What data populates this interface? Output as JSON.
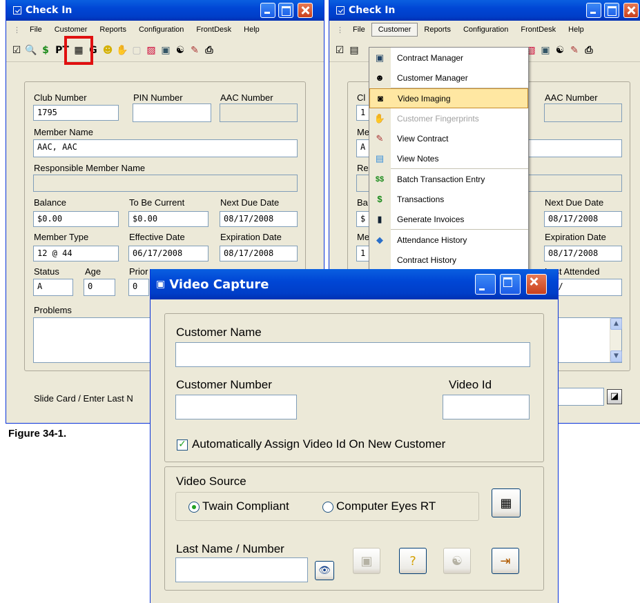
{
  "left_window": {
    "title": "Check In",
    "menu": [
      "File",
      "Customer",
      "Reports",
      "Configuration",
      "FrontDesk",
      "Help"
    ],
    "toolbar_icons": [
      "checkbox-icon",
      "search-doc-icon",
      "dollar-icon",
      "pt-icon",
      "video-icon",
      "g-icon",
      "smiley-icon",
      "hand-icon",
      "image-icon",
      "chart-icon",
      "contract-icon",
      "fingerprint-icon",
      "edit-icon",
      "print-icon"
    ],
    "toolbar_text": {
      "dollar": "$",
      "pt": "PT",
      "g": "G"
    },
    "fields": {
      "club_number_label": "Club Number",
      "club_number": "1795",
      "pin_number_label": "PIN Number",
      "pin_number": "",
      "aac_number_label": "AAC Number",
      "aac_number": "",
      "member_name_label": "Member Name",
      "member_name": "AAC, AAC",
      "responsible_label": "Responsible Member Name",
      "responsible": "",
      "balance_label": "Balance",
      "balance": "$0.00",
      "to_be_current_label": "To Be Current",
      "to_be_current": "$0.00",
      "next_due_label": "Next Due Date",
      "next_due": "08/17/2008",
      "member_type_label": "Member Type",
      "member_type": "12 @ 44",
      "effective_label": "Effective Date",
      "effective": "06/17/2008",
      "expiration_label": "Expiration Date",
      "expiration": "08/17/2008",
      "status_label": "Status",
      "status": "A",
      "age_label": "Age",
      "age": "0",
      "prior_label": "Prior",
      "prior": "0",
      "problems_label": "Problems"
    },
    "slide_card_label": "Slide Card / Enter Last N"
  },
  "right_window": {
    "title": "Check In",
    "menu": [
      "File",
      "Customer",
      "Reports",
      "Configuration",
      "FrontDesk",
      "Help"
    ],
    "aac_number_label": "AAC Number",
    "next_due_label": "Next Due Date",
    "next_due": "08/17/2008",
    "expiration_label": "Expiration Date",
    "expiration": "08/17/2008",
    "last_attended_label": "Last Attended",
    "last_attended": "/ /",
    "partial_labels": {
      "club": "Cl",
      "member": "Me",
      "resp": "Re",
      "balance": "Ba",
      "memtype": "Me"
    },
    "partial_values": {
      "club": "1",
      "member": "A",
      "balance": "$",
      "memtype": "1"
    },
    "customer_menu": [
      {
        "label": "Contract Manager",
        "icon": "contract-icon",
        "glyph": "▣",
        "state": "normal"
      },
      {
        "label": "Customer Manager",
        "icon": "customer-manager-icon",
        "glyph": "☻",
        "state": "normal"
      },
      {
        "label": "Video Imaging",
        "icon": "camera-icon",
        "glyph": "◙",
        "state": "highlighted"
      },
      {
        "label": "Customer Fingerprints",
        "icon": "hand-icon",
        "glyph": "✋",
        "state": "disabled"
      },
      {
        "label": "View Contract",
        "icon": "edit-icon",
        "glyph": "✎",
        "state": "normal"
      },
      {
        "label": "View Notes",
        "icon": "notes-icon",
        "glyph": "▤",
        "state": "normal"
      },
      {
        "label": "Batch Transaction Entry",
        "icon": "batch-dollar-icon",
        "glyph": "$$",
        "state": "normal"
      },
      {
        "label": "Transactions",
        "icon": "dollar-icon",
        "glyph": "$",
        "state": "normal"
      },
      {
        "label": "Generate Invoices",
        "icon": "invoice-icon",
        "glyph": "▮",
        "state": "normal"
      },
      {
        "label": "Attendance History",
        "icon": "attendance-icon",
        "glyph": "◆",
        "state": "normal"
      },
      {
        "label": "Contract History",
        "icon": "history-icon",
        "glyph": "",
        "state": "normal"
      }
    ]
  },
  "figure_caption": "Figure 34-1.",
  "video_capture": {
    "title": "Video Capture",
    "customer_name_label": "Customer Name",
    "customer_name": "",
    "customer_number_label": "Customer Number",
    "customer_number": "",
    "video_id_label": "Video Id",
    "video_id": "",
    "auto_assign_label": "Automatically Assign Video Id On New Customer",
    "auto_assign_checked": true,
    "video_source_label": "Video Source",
    "twain_label": "Twain Compliant",
    "computer_eyes_label": "Computer Eyes RT",
    "selected_source": "Twain Compliant",
    "last_name_label": "Last Name / Number",
    "last_name": ""
  }
}
